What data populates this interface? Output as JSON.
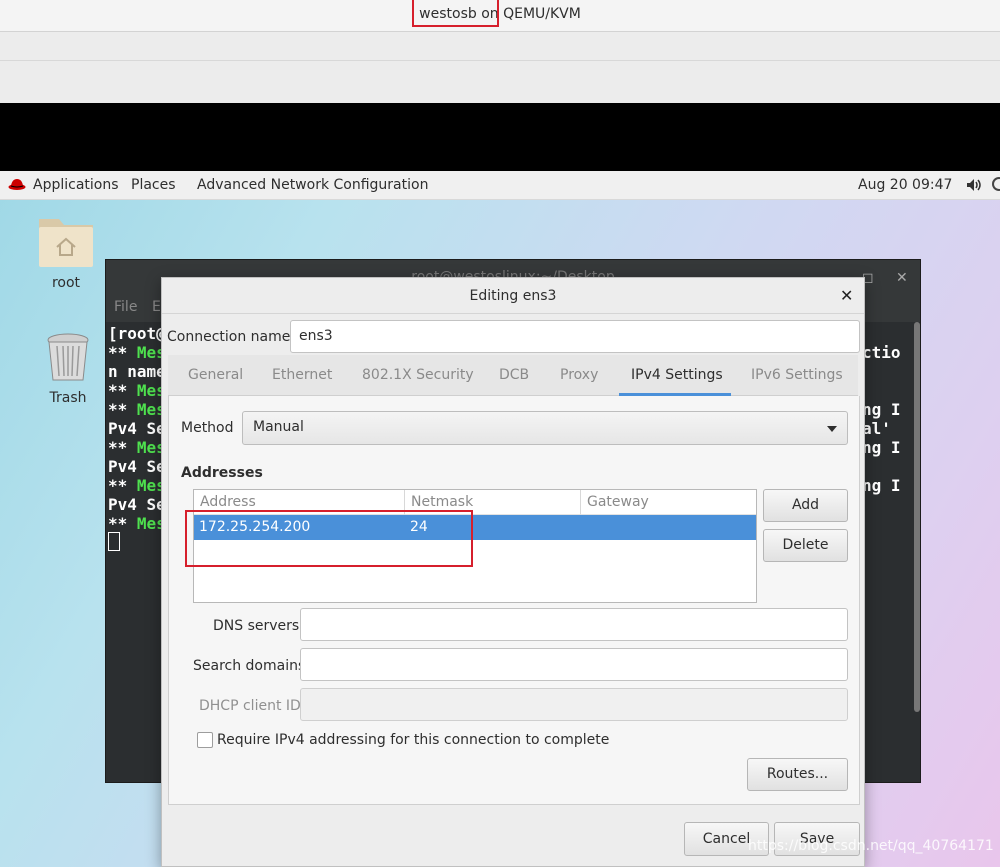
{
  "host": {
    "title": "westosb on QEMU/KVM"
  },
  "topbar": {
    "applications": "Applications",
    "places": "Places",
    "app_name": "Advanced Network Configuration",
    "clock": "Aug 20  09:47"
  },
  "desktop_icons": [
    {
      "label": "root",
      "icon": "home-folder-icon"
    },
    {
      "label": "Trash",
      "icon": "trash-icon"
    }
  ],
  "terminal": {
    "title": "root@westoslinux:~/Desktop",
    "menu": [
      "File",
      "E"
    ],
    "lines": [
      {
        "white": "[root@",
        "green": ""
      },
      {
        "white": "** ",
        "green": "Mes"
      },
      {
        "white": "n name",
        "green": ""
      },
      {
        "white": "** ",
        "green": "Mes"
      },
      {
        "white": "** ",
        "green": "Mes"
      },
      {
        "white": "Pv4 Se",
        "green": ""
      },
      {
        "white": "** ",
        "green": "Mes"
      },
      {
        "white": "Pv4 Se",
        "green": ""
      },
      {
        "white": "** ",
        "green": "Mes"
      },
      {
        "white": "Pv4 Se",
        "green": ""
      },
      {
        "white": "** ",
        "green": "Mes"
      }
    ],
    "right_fragments": [
      "ctio",
      "ng I",
      "al'",
      "ng I",
      "ng I"
    ]
  },
  "dialog": {
    "title": "Editing ens3",
    "connection_name_label": "Connection name",
    "connection_name_value": "ens3",
    "tabs": [
      "General",
      "Ethernet",
      "802.1X Security",
      "DCB",
      "Proxy",
      "IPv4 Settings",
      "IPv6 Settings"
    ],
    "active_tab": "IPv4 Settings",
    "method_label": "Method",
    "method_value": "Manual",
    "addresses_label": "Addresses",
    "columns": [
      "Address",
      "Netmask",
      "Gateway"
    ],
    "rows": [
      {
        "address": "172.25.254.200",
        "netmask": "24",
        "gateway": ""
      }
    ],
    "add_label": "Add",
    "delete_label": "Delete",
    "dns_label": "DNS servers",
    "dns_value": "",
    "search_label": "Search domains",
    "search_value": "",
    "dhcp_label": "DHCP client ID",
    "dhcp_value": "",
    "require_ipv4_label": "Require IPv4 addressing for this connection to complete",
    "require_ipv4_checked": false,
    "routes_label": "Routes...",
    "cancel_label": "Cancel",
    "save_label": "Save"
  },
  "watermark": "https://blog.csdn.net/qq_40764171",
  "colors": {
    "selection": "#4a90d9",
    "annotation_box": "#d61f2c",
    "terminal_green": "#4fe24f"
  }
}
